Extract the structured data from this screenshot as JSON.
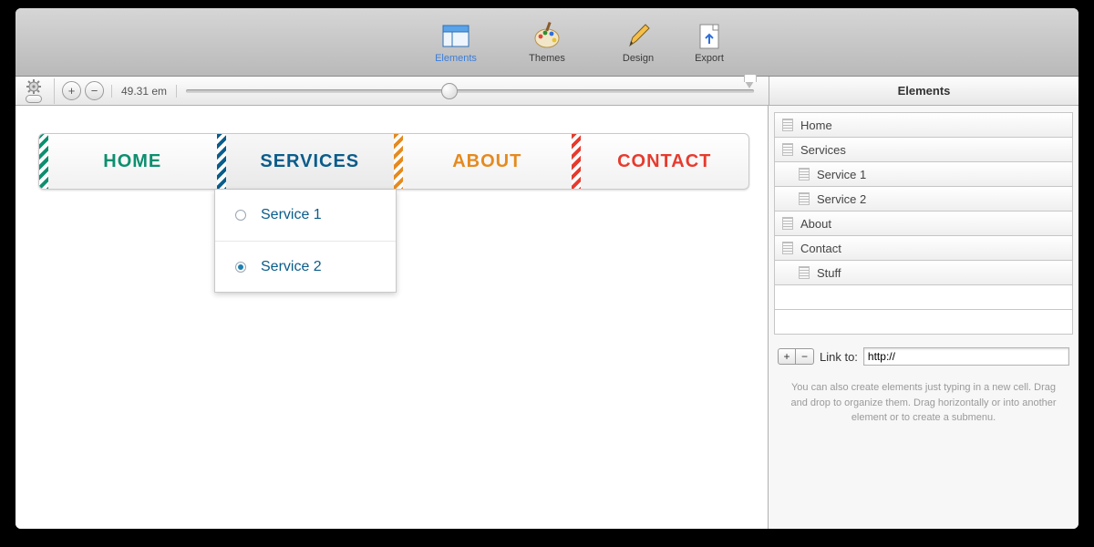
{
  "toolbar": {
    "items": [
      {
        "id": "elements",
        "label": "Elements"
      },
      {
        "id": "themes",
        "label": "Themes"
      },
      {
        "id": "design",
        "label": "Design"
      }
    ],
    "export_label": "Export",
    "active": "elements"
  },
  "subbar": {
    "zoom_label": "49.31 em"
  },
  "inspector": {
    "title": "Elements",
    "tree": {
      "home": "Home",
      "services": "Services",
      "service1": "Service 1",
      "service2": "Service 2",
      "about": "About",
      "contact": "Contact",
      "stuff": "Stuff"
    },
    "linkto_label": "Link to:",
    "linkto_value": "http://",
    "hint": "You can also create elements just typing in a new cell. Drag and drop to organize them. Drag horizontally or into another element or to create a submenu."
  },
  "preview": {
    "nav": {
      "home": "HOME",
      "services": "SERVICES",
      "about": "ABOUT",
      "contact": "CONTACT"
    },
    "dropdown": {
      "item1": "Service 1",
      "item2": "Service 2"
    }
  }
}
